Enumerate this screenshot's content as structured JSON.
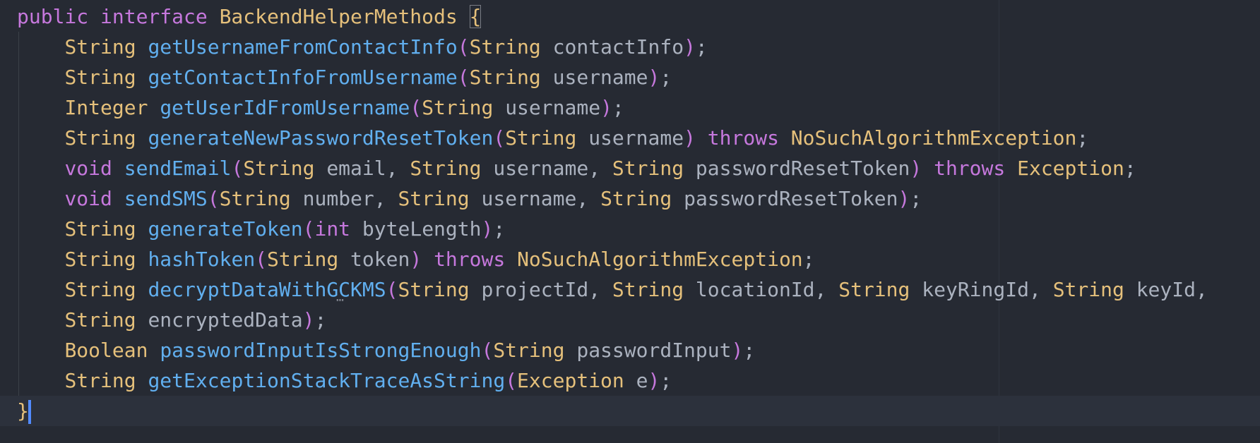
{
  "editor": {
    "colors": {
      "background": "#262a33",
      "keyword": "#c678dd",
      "type": "#e5c07b",
      "function": "#61afef",
      "plain": "#abb2bf",
      "paren": "#c678dd",
      "brace": "#e5c07b",
      "cursor": "#528bff"
    },
    "lines": [
      [
        {
          "t": "public interface",
          "c": "keyword"
        },
        {
          "t": " ",
          "c": "plain"
        },
        {
          "t": "BackendHelperMethods",
          "c": "type"
        },
        {
          "t": " ",
          "c": "plain"
        },
        {
          "t": "{",
          "c": "brace",
          "box": true
        }
      ],
      [
        {
          "t": "    ",
          "c": "plain"
        },
        {
          "t": "String",
          "c": "type"
        },
        {
          "t": " ",
          "c": "plain"
        },
        {
          "t": "getUsernameFromContactInfo",
          "c": "function"
        },
        {
          "t": "(",
          "c": "paren"
        },
        {
          "t": "String",
          "c": "type"
        },
        {
          "t": " contactInfo",
          "c": "plain"
        },
        {
          "t": ")",
          "c": "paren"
        },
        {
          "t": ";",
          "c": "plain"
        }
      ],
      [
        {
          "t": "    ",
          "c": "plain"
        },
        {
          "t": "String",
          "c": "type"
        },
        {
          "t": " ",
          "c": "plain"
        },
        {
          "t": "getContactInfoFromUsername",
          "c": "function"
        },
        {
          "t": "(",
          "c": "paren"
        },
        {
          "t": "String",
          "c": "type"
        },
        {
          "t": " username",
          "c": "plain"
        },
        {
          "t": ")",
          "c": "paren"
        },
        {
          "t": ";",
          "c": "plain"
        }
      ],
      [
        {
          "t": "    ",
          "c": "plain"
        },
        {
          "t": "Integer",
          "c": "type"
        },
        {
          "t": " ",
          "c": "plain"
        },
        {
          "t": "getUserIdFromUsername",
          "c": "function"
        },
        {
          "t": "(",
          "c": "paren"
        },
        {
          "t": "String",
          "c": "type"
        },
        {
          "t": " username",
          "c": "plain"
        },
        {
          "t": ")",
          "c": "paren"
        },
        {
          "t": ";",
          "c": "plain"
        }
      ],
      [
        {
          "t": "    ",
          "c": "plain"
        },
        {
          "t": "String",
          "c": "type"
        },
        {
          "t": " ",
          "c": "plain"
        },
        {
          "t": "generateNewPasswordResetToken",
          "c": "function"
        },
        {
          "t": "(",
          "c": "paren"
        },
        {
          "t": "String",
          "c": "type"
        },
        {
          "t": " username",
          "c": "plain"
        },
        {
          "t": ")",
          "c": "paren"
        },
        {
          "t": " ",
          "c": "plain"
        },
        {
          "t": "throws",
          "c": "keyword"
        },
        {
          "t": " ",
          "c": "plain"
        },
        {
          "t": "NoSuchAlgorithmException",
          "c": "type"
        },
        {
          "t": ";",
          "c": "plain"
        }
      ],
      [
        {
          "t": "    ",
          "c": "plain"
        },
        {
          "t": "void",
          "c": "keyword"
        },
        {
          "t": " ",
          "c": "plain"
        },
        {
          "t": "sendEmail",
          "c": "function"
        },
        {
          "t": "(",
          "c": "paren"
        },
        {
          "t": "String",
          "c": "type"
        },
        {
          "t": " email, ",
          "c": "plain"
        },
        {
          "t": "String",
          "c": "type"
        },
        {
          "t": " username, ",
          "c": "plain"
        },
        {
          "t": "String",
          "c": "type"
        },
        {
          "t": " passwordResetToken",
          "c": "plain"
        },
        {
          "t": ")",
          "c": "paren"
        },
        {
          "t": " ",
          "c": "plain"
        },
        {
          "t": "throws",
          "c": "keyword"
        },
        {
          "t": " ",
          "c": "plain"
        },
        {
          "t": "Exception",
          "c": "type"
        },
        {
          "t": ";",
          "c": "plain"
        }
      ],
      [
        {
          "t": "    ",
          "c": "plain"
        },
        {
          "t": "void",
          "c": "keyword"
        },
        {
          "t": " ",
          "c": "plain"
        },
        {
          "t": "sendSMS",
          "c": "function"
        },
        {
          "t": "(",
          "c": "paren"
        },
        {
          "t": "String",
          "c": "type"
        },
        {
          "t": " number, ",
          "c": "plain"
        },
        {
          "t": "String",
          "c": "type"
        },
        {
          "t": " username, ",
          "c": "plain"
        },
        {
          "t": "String",
          "c": "type"
        },
        {
          "t": " passwordResetToken",
          "c": "plain"
        },
        {
          "t": ")",
          "c": "paren"
        },
        {
          "t": ";",
          "c": "plain"
        }
      ],
      [
        {
          "t": "    ",
          "c": "plain"
        },
        {
          "t": "String",
          "c": "type"
        },
        {
          "t": " ",
          "c": "plain"
        },
        {
          "t": "generateToken",
          "c": "function"
        },
        {
          "t": "(",
          "c": "paren"
        },
        {
          "t": "int",
          "c": "keyword"
        },
        {
          "t": " byteLength",
          "c": "plain"
        },
        {
          "t": ")",
          "c": "paren"
        },
        {
          "t": ";",
          "c": "plain"
        }
      ],
      [
        {
          "t": "    ",
          "c": "plain"
        },
        {
          "t": "String",
          "c": "type"
        },
        {
          "t": " ",
          "c": "plain"
        },
        {
          "t": "hashToken",
          "c": "function"
        },
        {
          "t": "(",
          "c": "paren"
        },
        {
          "t": "String",
          "c": "type"
        },
        {
          "t": " token",
          "c": "plain"
        },
        {
          "t": ")",
          "c": "paren"
        },
        {
          "t": " ",
          "c": "plain"
        },
        {
          "t": "throws",
          "c": "keyword"
        },
        {
          "t": " ",
          "c": "plain"
        },
        {
          "t": "NoSuchAlgorithmException",
          "c": "type"
        },
        {
          "t": ";",
          "c": "plain"
        }
      ],
      [
        {
          "t": "    ",
          "c": "plain"
        },
        {
          "t": "String",
          "c": "type"
        },
        {
          "t": " ",
          "c": "plain"
        },
        {
          "t": "decryptDataWithGCKMS",
          "c": "function"
        },
        {
          "t": "(",
          "c": "paren"
        },
        {
          "t": "String",
          "c": "type"
        },
        {
          "t": " projectId, ",
          "c": "plain"
        },
        {
          "t": "String",
          "c": "type"
        },
        {
          "t": " locationId, ",
          "c": "plain"
        },
        {
          "t": "String",
          "c": "type"
        },
        {
          "t": " keyRingId, ",
          "c": "plain"
        },
        {
          "t": "String",
          "c": "type"
        },
        {
          "t": " keyId,",
          "c": "plain"
        }
      ],
      [
        {
          "t": "    ",
          "c": "plain"
        },
        {
          "t": "String",
          "c": "type"
        },
        {
          "t": " encryptedData",
          "c": "plain"
        },
        {
          "t": ")",
          "c": "paren"
        },
        {
          "t": ";",
          "c": "plain"
        }
      ],
      [
        {
          "t": "    ",
          "c": "plain"
        },
        {
          "t": "Boolean",
          "c": "type"
        },
        {
          "t": " ",
          "c": "plain"
        },
        {
          "t": "passwordInputIsStrongEnough",
          "c": "function"
        },
        {
          "t": "(",
          "c": "paren"
        },
        {
          "t": "String",
          "c": "type"
        },
        {
          "t": " passwordInput",
          "c": "plain"
        },
        {
          "t": ")",
          "c": "paren"
        },
        {
          "t": ";",
          "c": "plain"
        }
      ],
      [
        {
          "t": "    ",
          "c": "plain"
        },
        {
          "t": "String",
          "c": "type"
        },
        {
          "t": " ",
          "c": "plain"
        },
        {
          "t": "getExceptionStackTraceAsString",
          "c": "function"
        },
        {
          "t": "(",
          "c": "paren"
        },
        {
          "t": "Exception",
          "c": "type"
        },
        {
          "t": " e",
          "c": "plain"
        },
        {
          "t": ")",
          "c": "paren"
        },
        {
          "t": ";",
          "c": "plain"
        }
      ],
      [
        {
          "t": "}",
          "c": "brace",
          "cursor": true
        }
      ]
    ]
  }
}
